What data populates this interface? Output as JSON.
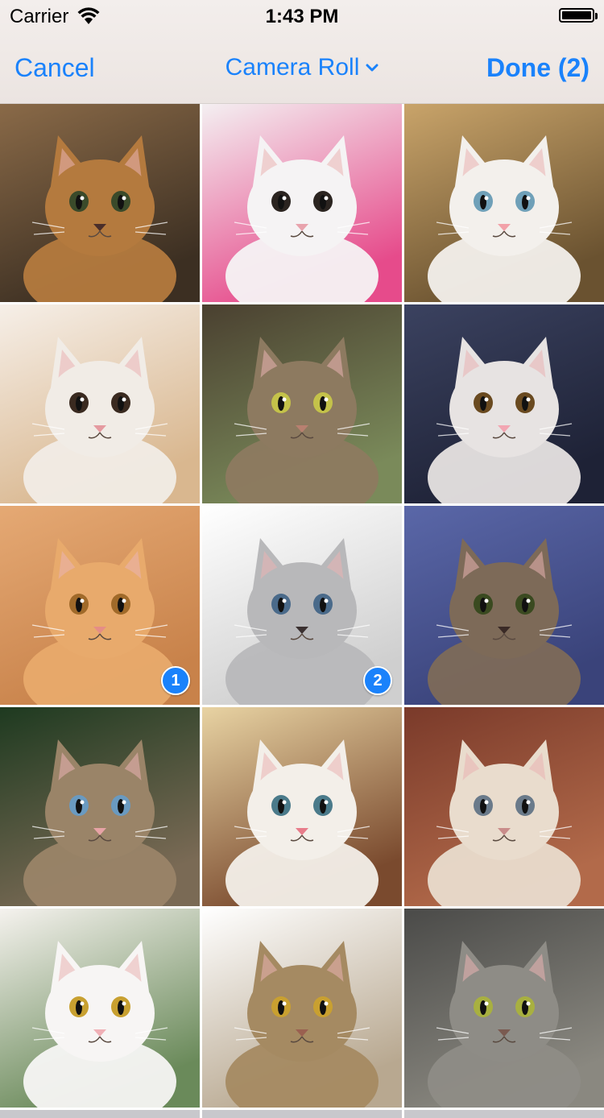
{
  "status_bar": {
    "carrier": "Carrier",
    "time": "1:43 PM"
  },
  "nav": {
    "cancel_label": "Cancel",
    "title": "Camera Roll",
    "done_label": "Done (2)"
  },
  "colors": {
    "accent": "#1a82fb"
  },
  "photos": [
    {
      "selected": false,
      "badge": ""
    },
    {
      "selected": false,
      "badge": ""
    },
    {
      "selected": false,
      "badge": ""
    },
    {
      "selected": false,
      "badge": ""
    },
    {
      "selected": false,
      "badge": ""
    },
    {
      "selected": false,
      "badge": ""
    },
    {
      "selected": true,
      "badge": "1"
    },
    {
      "selected": true,
      "badge": "2"
    },
    {
      "selected": false,
      "badge": ""
    },
    {
      "selected": false,
      "badge": ""
    },
    {
      "selected": false,
      "badge": ""
    },
    {
      "selected": false,
      "badge": ""
    },
    {
      "selected": false,
      "badge": ""
    },
    {
      "selected": false,
      "badge": ""
    },
    {
      "selected": false,
      "badge": ""
    }
  ]
}
